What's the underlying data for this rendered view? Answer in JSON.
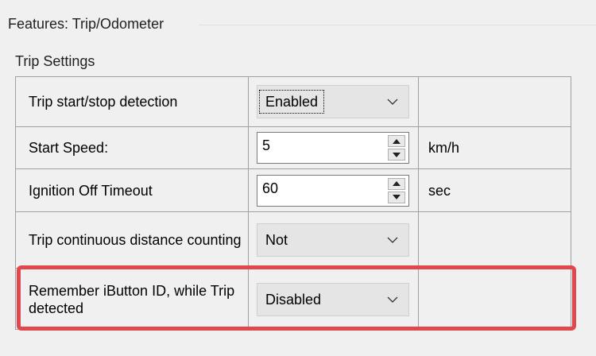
{
  "panel": {
    "title": "Features: Trip/Odometer"
  },
  "section": {
    "title": "Trip Settings"
  },
  "settings": {
    "rows": [
      {
        "label": "Trip start/stop detection",
        "control_type": "dropdown",
        "value": "Enabled",
        "unit": ""
      },
      {
        "label": "Start Speed:",
        "control_type": "spinner",
        "value": "5",
        "unit": "km/h"
      },
      {
        "label": "Ignition Off Timeout",
        "control_type": "spinner",
        "value": "60",
        "unit": "sec"
      },
      {
        "label": "Trip continuous distance counting",
        "control_type": "dropdown",
        "value": "Not",
        "unit": ""
      },
      {
        "label": "Remember iButton ID, while Trip detected",
        "control_type": "dropdown",
        "value": "Disabled",
        "unit": ""
      }
    ]
  },
  "colors": {
    "highlight": "#e1474d",
    "grid_border": "#a0a0a0",
    "window_bg": "#f0f0f0"
  },
  "icons": {
    "dropdown": "chevron-down-icon",
    "spinner_up": "spin-up-arrow-icon",
    "spinner_down": "spin-down-arrow-icon"
  }
}
